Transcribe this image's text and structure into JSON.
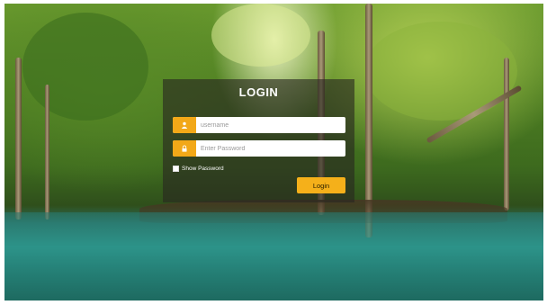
{
  "login": {
    "title": "LOGIN",
    "username": {
      "placeholder": "username",
      "value": "",
      "icon": "user-icon"
    },
    "password": {
      "placeholder": "Enter Password",
      "value": "",
      "icon": "lock-icon"
    },
    "show_password_label": "Show Password",
    "show_password_checked": false,
    "submit_label": "Login"
  },
  "colors": {
    "accent": "#f5b01a",
    "panel": "#28261f",
    "text_light": "#ffffff"
  }
}
